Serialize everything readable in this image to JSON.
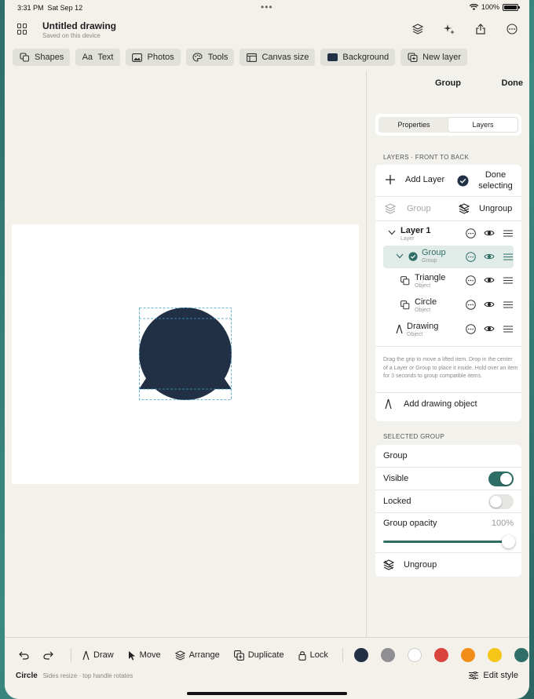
{
  "status": {
    "time": "3:31 PM",
    "date": "Sat Sep 12",
    "battery": "100%"
  },
  "header": {
    "title": "Untitled drawing",
    "subtitle": "Saved on this device"
  },
  "toolbar": {
    "shapes": "Shapes",
    "text": "Text",
    "photos": "Photos",
    "tools": "Tools",
    "canvas_size": "Canvas size",
    "background": "Background",
    "new_layer": "New layer"
  },
  "panel": {
    "title": "Group",
    "done": "Done",
    "tabs": {
      "properties": "Properties",
      "layers": "Layers"
    },
    "layers_label": "LAYERS · FRONT TO BACK",
    "add_layer": "Add Layer",
    "done_selecting": "Done selecting",
    "group": "Group",
    "ungroup": "Ungroup",
    "layers": [
      {
        "name": "Layer 1",
        "kind": "Layer"
      },
      {
        "name": "Group",
        "kind": "Group"
      },
      {
        "name": "Triangle",
        "kind": "Object"
      },
      {
        "name": "Circle",
        "kind": "Object"
      },
      {
        "name": "Drawing",
        "kind": "Object"
      }
    ],
    "help": "Drag the grip to move a lifted item. Drop in the center of a Layer or Group to place it inside. Hold over an item for 3 seconds to group compatible items.",
    "add_drawing": "Add drawing object",
    "selected_label": "SELECTED GROUP",
    "selected": {
      "name": "Group",
      "visible_label": "Visible",
      "visible": true,
      "locked_label": "Locked",
      "locked": false,
      "opacity_label": "Group opacity",
      "opacity": "100%",
      "ungroup": "Ungroup"
    }
  },
  "bottom": {
    "draw": "Draw",
    "move": "Move",
    "arrange": "Arrange",
    "duplicate": "Duplicate",
    "lock": "Lock",
    "colors": [
      "#223045",
      "#8e8e93",
      "#ffffff",
      "#d9443c",
      "#f28d1a",
      "#f5c518",
      "#2f6e66",
      "#1a7fe0"
    ],
    "selection": "Circle",
    "hint": "Sides resize · top handle rotates",
    "edit_style": "Edit style"
  },
  "colors": {
    "accent": "#2f6e66",
    "shape": "#223045"
  }
}
